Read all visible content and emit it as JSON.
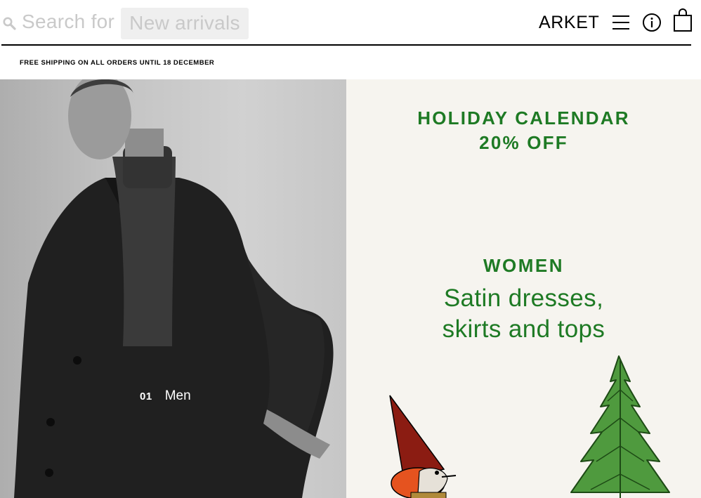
{
  "header": {
    "search_label": "Search for",
    "search_suggestion": "New arrivals",
    "logo": "ARKET",
    "icons": [
      "search-icon",
      "menu-icon",
      "info-icon",
      "shopping-bag-icon"
    ]
  },
  "promo_bar": {
    "text": "FREE SHIPPING ON ALL ORDERS UNTIL 18 DECEMBER"
  },
  "hero_men": {
    "number": "01",
    "label": "Men"
  },
  "promo_panel": {
    "title_line1": "HOLIDAY CALENDAR",
    "title_line2": "20% OFF",
    "category": "WOMEN",
    "subtitle_line1": "Satin dresses,",
    "subtitle_line2": "skirts and tops"
  },
  "colors": {
    "accent_green": "#1e7a24",
    "panel_bg": "#f6f4ef",
    "search_text": "#c9c9c9"
  }
}
